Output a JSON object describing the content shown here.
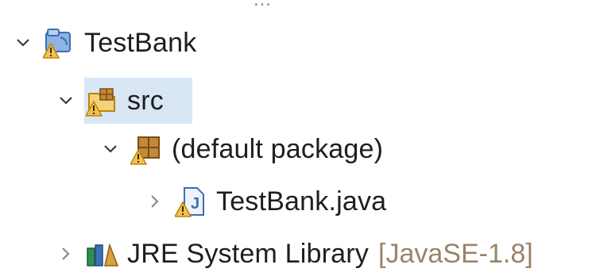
{
  "tree": {
    "items": [
      {
        "label": "TestBank",
        "expanded": true,
        "icon": "java-project-warning-icon",
        "twisty": "chevron-down-icon"
      },
      {
        "label": "src",
        "expanded": true,
        "selected": true,
        "icon": "source-folder-warning-icon",
        "twisty": "chevron-down-icon"
      },
      {
        "label": "(default package)",
        "expanded": true,
        "icon": "package-warning-icon",
        "twisty": "chevron-down-icon"
      },
      {
        "label": "TestBank.java",
        "expanded": false,
        "icon": "java-file-warning-icon",
        "twisty": "chevron-right-icon"
      },
      {
        "label": "JRE System Library",
        "decoration": "[JavaSE-1.8]",
        "expanded": false,
        "icon": "library-icon",
        "twisty": "chevron-right-icon"
      }
    ]
  },
  "colors": {
    "selection": "#d9e7f5",
    "decoration": "#9a8468",
    "warning": "#f2c14e",
    "java_blue": "#3a6fb0"
  }
}
